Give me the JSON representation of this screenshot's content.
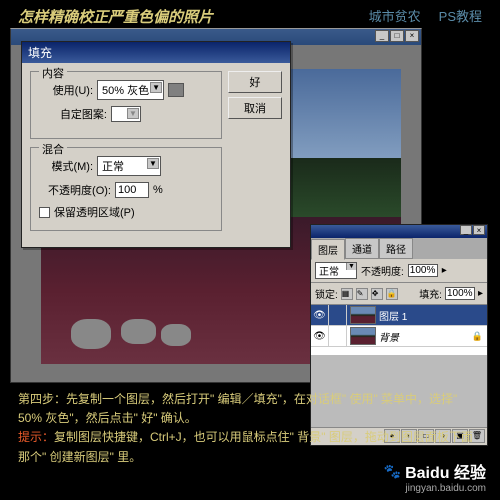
{
  "header": {
    "title": "怎样精确校正严重色偏的照片",
    "link1": "城市贫农",
    "link2": "PS教程"
  },
  "dialog": {
    "title": "填充",
    "content_group": "内容",
    "use_label": "使用(U):",
    "use_value": "50% 灰色",
    "custom_label": "自定图案:",
    "blend_group": "混合",
    "mode_label": "模式(M):",
    "mode_value": "正常",
    "opacity_label": "不透明度(O):",
    "opacity_value": "100",
    "opacity_pct": "%",
    "preserve_label": "保留透明区域(P)",
    "ok": "好",
    "cancel": "取消"
  },
  "layers": {
    "tab1": "图层",
    "tab2": "通道",
    "tab3": "路径",
    "mode": "正常",
    "opacity_label": "不透明度:",
    "opacity_value": "100%",
    "lock_label": "锁定:",
    "fill_label": "填充:",
    "fill_value": "100%",
    "layer1_name": "图层 1",
    "bg_name": "背景",
    "lock_icon": "🔒"
  },
  "caption": {
    "step": "第四步：先复制一个图层，然后打开\" 编辑／填充\"，在对话框\" 使用\" 菜单中，选择\" 50% 灰色\"，然后点击\" 好\" 确认。",
    "hint_label": "提示：",
    "hint": "复制图层快捷键，Ctrl+J，也可以用鼠标点住\" 背景\" 图层，拖动到图层面板下面那个\" 创建新图层\" 里。"
  },
  "watermark": {
    "brand": "Baidu 经验",
    "url": "jingyan.baidu.com"
  }
}
